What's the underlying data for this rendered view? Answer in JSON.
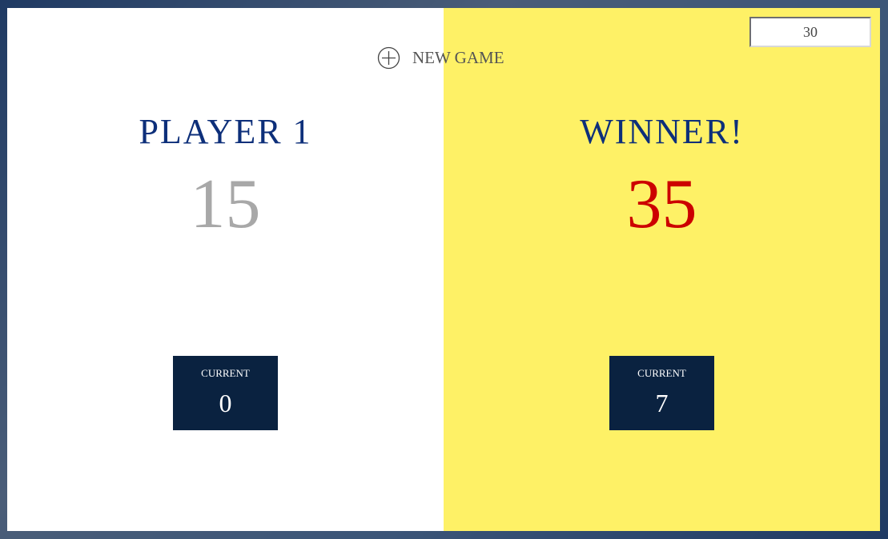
{
  "new_game": {
    "label": "NEW GAME",
    "icon": "plus-circle-icon"
  },
  "final_score_input": {
    "value": "30"
  },
  "players": [
    {
      "name": "PLAYER 1",
      "score": "15",
      "current_label": "CURRENT",
      "current_score": "0",
      "panel_color": "#ffffff",
      "score_color": "#a8a8a8"
    },
    {
      "name": "WINNER!",
      "score": "35",
      "current_label": "CURRENT",
      "current_score": "7",
      "panel_color": "#fef166",
      "score_color": "#cc0000",
      "winner": true
    }
  ],
  "colors": {
    "name_blue": "#0d2f7a",
    "current_box": "#0a2240"
  }
}
